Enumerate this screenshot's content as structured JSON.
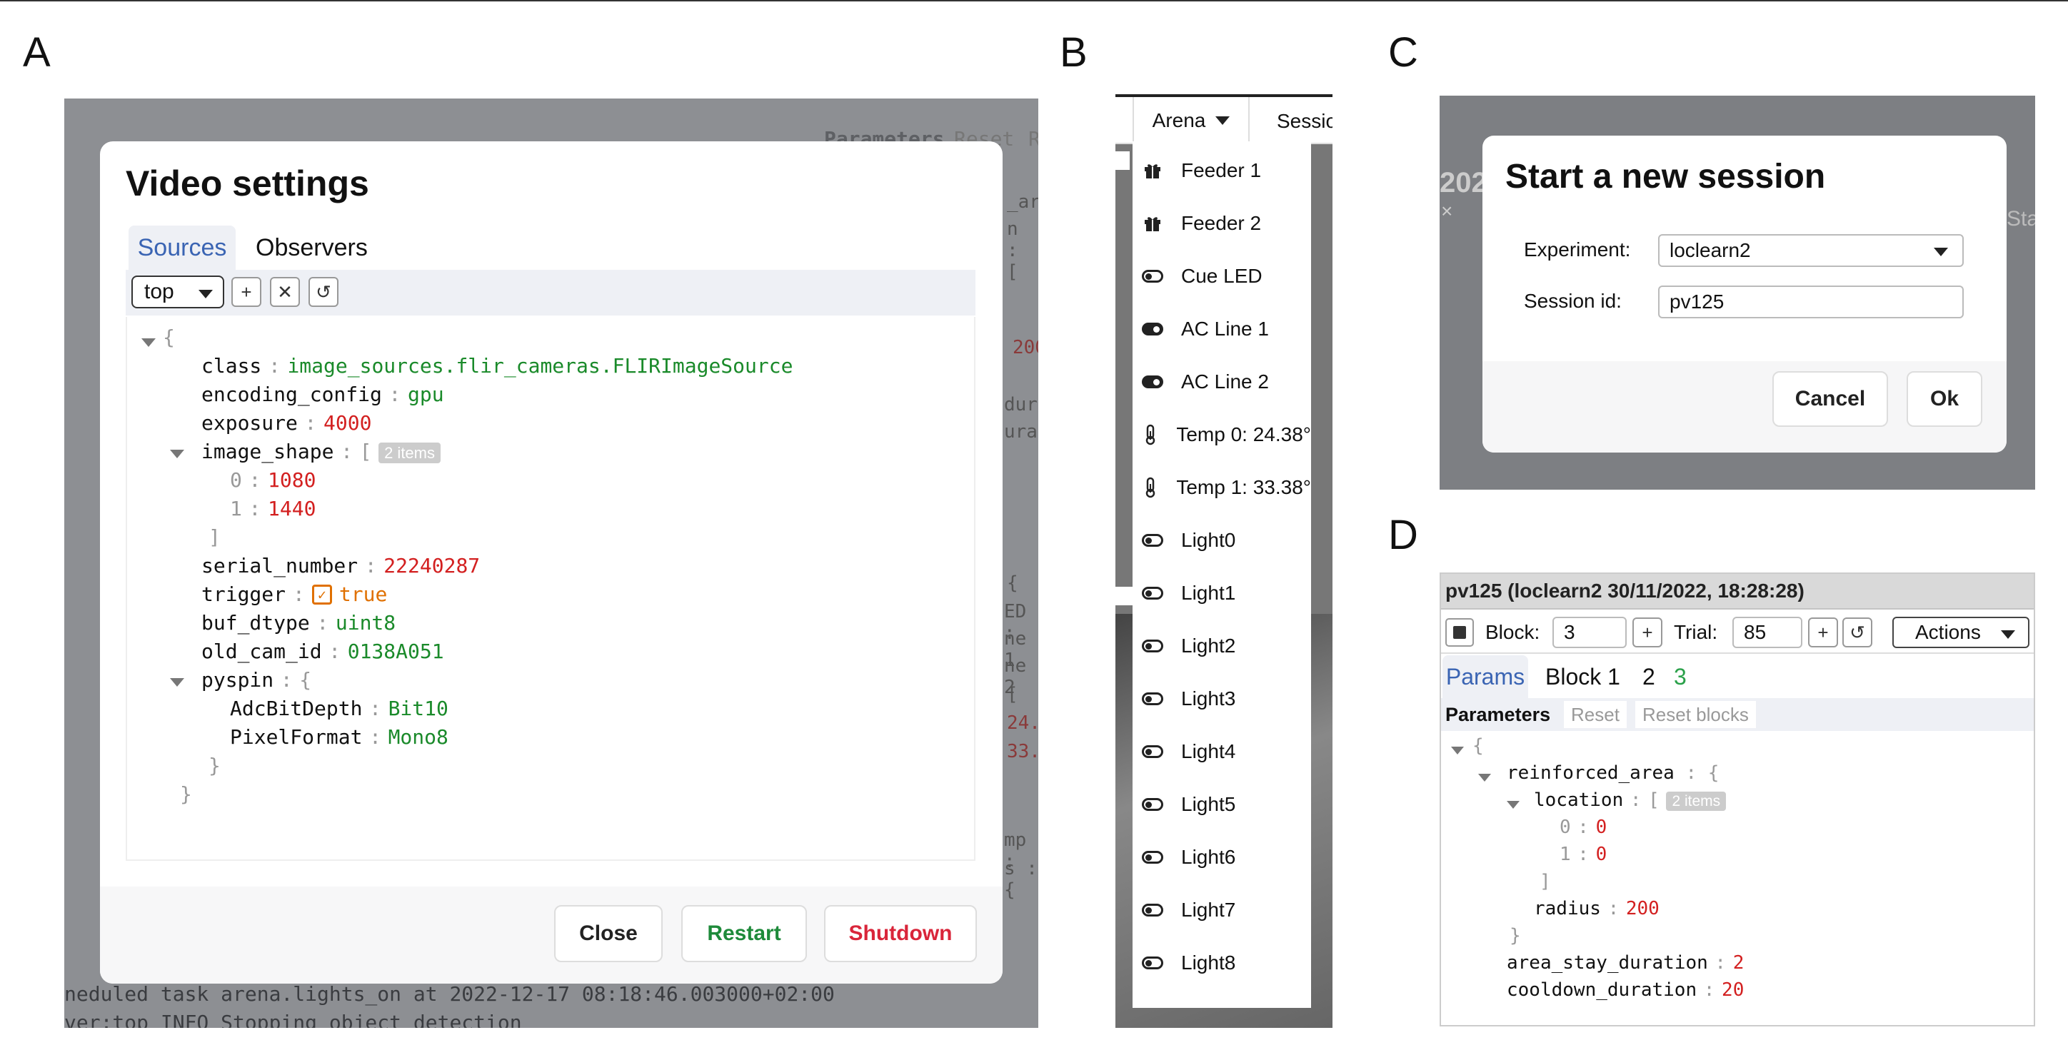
{
  "panel_labels": {
    "a": "A",
    "b": "B",
    "c": "C",
    "d": "D"
  },
  "panel_a": {
    "title": "Video settings",
    "tabs": [
      "Sources",
      "Observers"
    ],
    "source_select": "top",
    "toolbar_icons": [
      "plus-icon",
      "close-icon",
      "undo-icon"
    ],
    "json": {
      "open_brace": "{",
      "close_brace": "}",
      "class_key": "class",
      "class_val": "image_sources.flir_cameras.FLIRImageSource",
      "encoding_key": "encoding_config",
      "encoding_val": "gpu",
      "exposure_key": "exposure",
      "exposure_val": "4000",
      "image_shape_key": "image_shape",
      "image_shape_open": "[",
      "image_shape_badge": "2 items",
      "shape_0_idx": "0",
      "shape_0_val": "1080",
      "shape_1_idx": "1",
      "shape_1_val": "1440",
      "image_shape_close": "]",
      "serial_key": "serial_number",
      "serial_val": "22240287",
      "trigger_key": "trigger",
      "trigger_val": "true",
      "buf_key": "buf_dtype",
      "buf_val": "uint8",
      "oldcam_key": "old_cam_id",
      "oldcam_val": "0138A051",
      "pyspin_key": "pyspin",
      "pyspin_open": "{",
      "adc_key": "AdcBitDepth",
      "adc_val": "Bit10",
      "pixel_key": "PixelFormat",
      "pixel_val": "Mono8",
      "pyspin_close": "}",
      "sep": ":"
    },
    "buttons": {
      "close": "Close",
      "restart": "Restart",
      "shutdown": "Shutdown"
    },
    "background_log": [
      "neduled task arena.lights_on at 2022-12-17 08:18:46.003000+02:00",
      "ver:top INFO      Stopping object detection"
    ],
    "background_fragments": {
      "parameters": "Parameters",
      "reset": "Reset",
      "r": "R",
      "num_200": "200",
      "dura1": "dura",
      "dura2": "ura",
      "bracket": "[",
      "brace": "{",
      "ed": "ED :",
      "ne1": "ne 1",
      "ne2": "ne 2",
      "num_24": "24.",
      "num_33": "33.",
      "mp": "mp :",
      "s": "s : {",
      "ar": "_ar",
      "n": "n : ["
    }
  },
  "panel_b": {
    "tabs": [
      "Arena",
      "Sessio"
    ],
    "items": [
      {
        "icon": "gift-icon",
        "label": "Feeder 1"
      },
      {
        "icon": "gift-icon",
        "label": "Feeder 2"
      },
      {
        "icon": "toggle-off-icon",
        "label": "Cue LED"
      },
      {
        "icon": "toggle-on-icon",
        "label": "AC Line 1"
      },
      {
        "icon": "toggle-on-icon",
        "label": "AC Line 2"
      },
      {
        "icon": "thermometer-icon",
        "label": "Temp 0: 24.38°"
      },
      {
        "icon": "thermometer-icon",
        "label": "Temp 1: 33.38°"
      },
      {
        "icon": "toggle-off-icon",
        "label": "Light0"
      },
      {
        "icon": "toggle-off-icon",
        "label": "Light1"
      },
      {
        "icon": "toggle-off-icon",
        "label": "Light2"
      },
      {
        "icon": "toggle-off-icon",
        "label": "Light3"
      },
      {
        "icon": "toggle-off-icon",
        "label": "Light4"
      },
      {
        "icon": "toggle-off-icon",
        "label": "Light5"
      },
      {
        "icon": "toggle-off-icon",
        "label": "Light6"
      },
      {
        "icon": "toggle-off-icon",
        "label": "Light7"
      },
      {
        "icon": "toggle-off-icon",
        "label": "Light8"
      }
    ]
  },
  "panel_c": {
    "title": "Start a new session",
    "experiment_label": "Experiment:",
    "experiment_value": "loclearn2",
    "session_label": "Session id:",
    "session_value": "pv125",
    "buttons": {
      "cancel": "Cancel",
      "ok": "Ok"
    },
    "bg_text": {
      "num": "202",
      "x": "×",
      "sta": "Sta"
    }
  },
  "panel_d": {
    "header": "pv125 (loclearn2 30/11/2022, 18:28:28)",
    "block_label": "Block:",
    "block_value": "3",
    "trial_label": "Trial:",
    "trial_value": "85",
    "actions": "Actions",
    "tabs": [
      "Params",
      "Block 1",
      "2",
      "3"
    ],
    "subtabs": [
      "Parameters",
      "Reset",
      "Reset blocks"
    ],
    "json": {
      "open": "{",
      "reinforced_key": "reinforced_area",
      "reinforced_open": "{",
      "location_key": "location",
      "location_open": "[",
      "location_badge": "2 items",
      "loc_0_idx": "0",
      "loc_0_val": "0",
      "loc_1_idx": "1",
      "loc_1_val": "0",
      "location_close": "]",
      "radius_key": "radius",
      "radius_val": "200",
      "reinforced_close": "}",
      "stay_key": "area_stay_duration",
      "stay_val": "2",
      "cooldown_key": "cooldown_duration",
      "cooldown_val": "20",
      "sep": ":"
    }
  },
  "colors": {
    "accent_blue": "#3a64b3",
    "green": "#1a8a2a",
    "red": "#d32020",
    "orange": "#e07000"
  }
}
